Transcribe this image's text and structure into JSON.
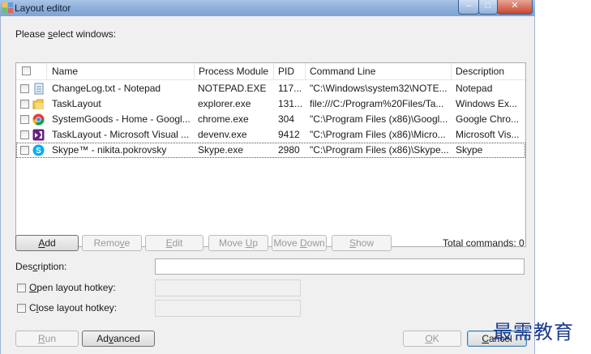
{
  "window": {
    "title": "Layout editor",
    "controls": {
      "minimize": "–",
      "maximize": "□",
      "close": "✕"
    }
  },
  "prompt": {
    "prefix": "Please ",
    "hotkey": "s",
    "suffix": "elect windows:"
  },
  "table": {
    "columns": [
      "Name",
      "Process Module",
      "PID",
      "Command Line",
      "Description"
    ],
    "rows": [
      {
        "icon": "notepad-icon",
        "name": "ChangeLog.txt - Notepad",
        "module": "NOTEPAD.EXE",
        "pid": "117...",
        "cmd": "\"C:\\Windows\\system32\\NOTE...",
        "desc": "Notepad",
        "checked": false,
        "selected": false
      },
      {
        "icon": "folder-icon",
        "name": "TaskLayout",
        "module": "explorer.exe",
        "pid": "131...",
        "cmd": "file:///C:/Program%20Files/Ta...",
        "desc": "Windows Ex...",
        "checked": false,
        "selected": false
      },
      {
        "icon": "chrome-icon",
        "name": "SystemGoods - Home - Googl...",
        "module": "chrome.exe",
        "pid": "304",
        "cmd": "\"C:\\Program Files (x86)\\Googl...",
        "desc": "Google Chro...",
        "checked": false,
        "selected": false
      },
      {
        "icon": "visual-studio-icon",
        "name": "TaskLayout - Microsoft Visual ...",
        "module": "devenv.exe",
        "pid": "9412",
        "cmd": "\"C:\\Program Files (x86)\\Micro...",
        "desc": "Microsoft Vis...",
        "checked": false,
        "selected": false
      },
      {
        "icon": "skype-icon",
        "name": "Skype™ - nikita.pokrovsky",
        "module": "Skype.exe",
        "pid": "2980",
        "cmd": "\"C:\\Program Files (x86)\\Skype...",
        "desc": "Skype",
        "checked": false,
        "selected": true
      }
    ]
  },
  "buttons": {
    "add": {
      "prefix": "",
      "hotkey": "A",
      "suffix": "dd"
    },
    "remove": {
      "prefix": "Remo",
      "hotkey": "v",
      "suffix": "e"
    },
    "edit": {
      "prefix": "",
      "hotkey": "E",
      "suffix": "dit"
    },
    "move_up": {
      "prefix": "Move ",
      "hotkey": "U",
      "suffix": "p"
    },
    "move_down": {
      "prefix": "Move ",
      "hotkey": "D",
      "suffix": "own"
    },
    "show": {
      "prefix": "",
      "hotkey": "S",
      "suffix": "how"
    },
    "run": {
      "prefix": "",
      "hotkey": "R",
      "suffix": "un"
    },
    "advanced": {
      "prefix": "Ad",
      "hotkey": "v",
      "suffix": "anced"
    },
    "ok": {
      "prefix": "",
      "hotkey": "O",
      "suffix": "K"
    },
    "cancel": {
      "prefix": "",
      "hotkey": "C",
      "suffix": "ancel"
    }
  },
  "total_commands": "Total commands: 0",
  "description": {
    "prefix": "Des",
    "hotkey": "c",
    "suffix": "ription:",
    "value": ""
  },
  "open_hotkey": {
    "prefix": "",
    "hotkey": "O",
    "suffix": "pen layout hotkey:",
    "checked": false,
    "value": ""
  },
  "close_hotkey": {
    "prefix": "C",
    "hotkey": "l",
    "suffix": "ose layout hotkey:",
    "checked": false,
    "value": ""
  },
  "watermark": "最需教育",
  "colors": {
    "title_bar": "#8fb0da",
    "window_bg": "#f0f0f0",
    "close_button": "#c8452c",
    "watermark": "#1a3a8c"
  }
}
